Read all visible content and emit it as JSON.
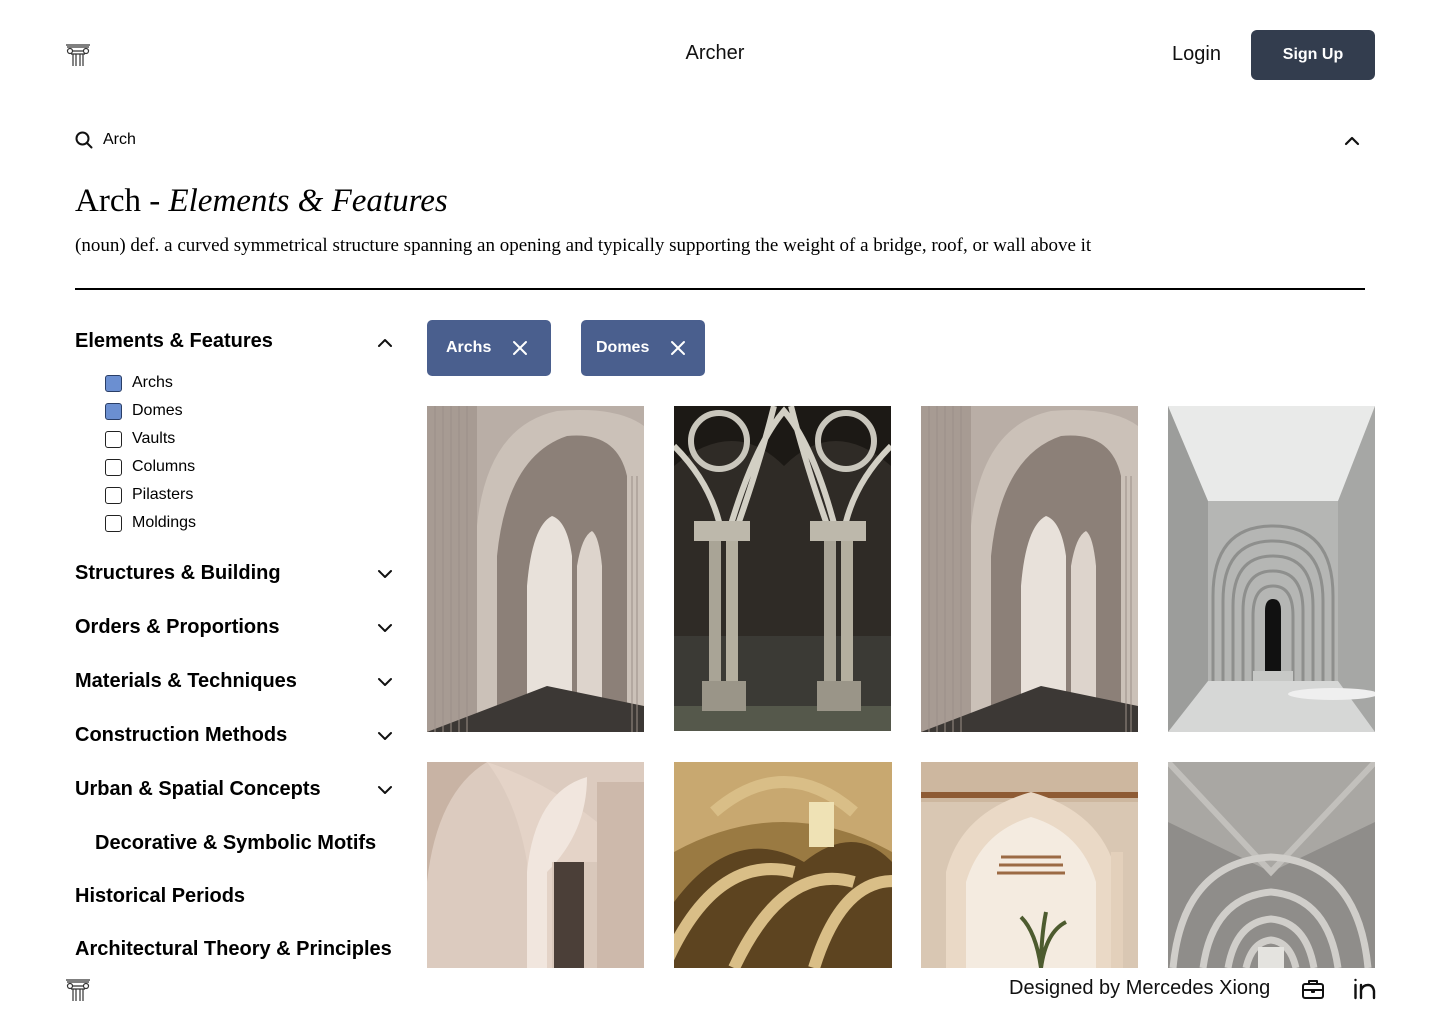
{
  "header": {
    "logo_icon": "ionic-column-capital-icon",
    "brand": "Archer",
    "login_label": "Login",
    "signup_label": "Sign Up"
  },
  "search": {
    "value": "Arch",
    "icon": "search-icon",
    "toggle_icon": "chevron-up-icon"
  },
  "term": {
    "word": "Arch",
    "separator": " - ",
    "category": "Elements & Features",
    "definition": "(noun) def. a curved symmetrical structure spanning an opening and typically supporting the weight of a bridge, roof, or wall above it"
  },
  "sidebar": {
    "expanded": {
      "label": "Elements & Features",
      "options": [
        {
          "label": "Archs",
          "checked": true
        },
        {
          "label": "Domes",
          "checked": true
        },
        {
          "label": "Vaults",
          "checked": false
        },
        {
          "label": "Columns",
          "checked": false
        },
        {
          "label": "Pilasters",
          "checked": false
        },
        {
          "label": "Moldings",
          "checked": false
        }
      ]
    },
    "collapsed": [
      {
        "label": "Structures & Building"
      },
      {
        "label": "Orders & Proportions"
      },
      {
        "label": "Materials & Techniques"
      },
      {
        "label": "Construction Methods"
      },
      {
        "label": "Urban & Spatial Concepts"
      }
    ],
    "plain": [
      {
        "label": "Decorative & Symbolic Motifs"
      },
      {
        "label": "Historical Periods"
      },
      {
        "label": "Architectural Theory & Principles"
      }
    ]
  },
  "filters": {
    "chips": [
      {
        "label": "Archs"
      },
      {
        "label": "Domes"
      }
    ],
    "chip_color": "#4a5f8e"
  },
  "gallery": [
    {
      "subject": "fluted-arch-corridor"
    },
    {
      "subject": "gothic-cloister-columns"
    },
    {
      "subject": "fluted-arch-corridor"
    },
    {
      "subject": "concentric-concrete-arch-portal"
    },
    {
      "subject": "plaster-arch-passage"
    },
    {
      "subject": "romanesque-vaulted-hall"
    },
    {
      "subject": "pointed-arch-whitewashed-hall"
    },
    {
      "subject": "concrete-cross-vault-colonnade"
    }
  ],
  "footer": {
    "credit": "Designed by Mercedes Xiong",
    "portfolio_icon": "briefcase-icon",
    "social_icon": "linkedin-icon"
  },
  "colors": {
    "primary_button": "#333d4e",
    "chip": "#4a5f8e",
    "checkbox_checked": "#6b8fd1"
  }
}
